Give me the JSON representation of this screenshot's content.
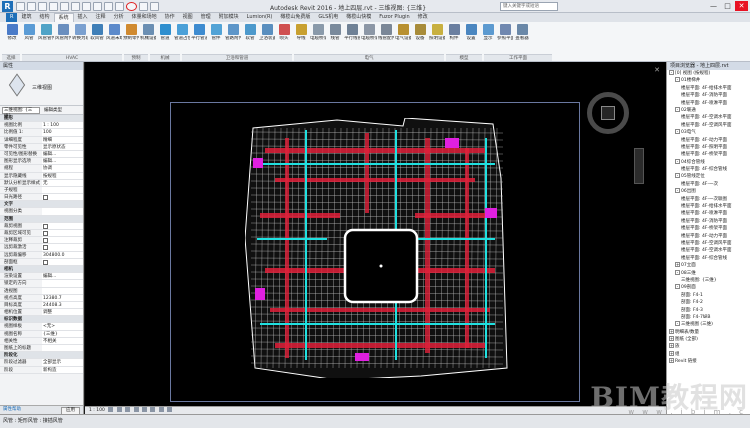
{
  "titlebar": {
    "title": "Autodesk Revit 2016 -    地上四层.rvt - 三维视图: {三维}",
    "search_placeholder": "键入关键字或短语",
    "minimize": "—",
    "maximize": "□",
    "close": "✕"
  },
  "tabs": [
    "R",
    "建筑",
    "结构",
    "系统",
    "插入",
    "注释",
    "分析",
    "体量和场地",
    "协作",
    "视图",
    "管理",
    "附加模块",
    "Lumion(R)",
    "橄榄山免费版",
    "GLS机电",
    "橄榄山快模",
    "Fuzor Plugin",
    "修改"
  ],
  "active_tab_index": 3,
  "ribbon": {
    "buttons": [
      {
        "label": "修改",
        "icon": "modify-arrow-icon"
      },
      {
        "label": "风管",
        "icon": "duct-icon"
      },
      {
        "label": "风管管件",
        "icon": "duct-fitting-icon"
      },
      {
        "label": "风管附件",
        "icon": "duct-accessory-icon"
      },
      {
        "label": "转换为软风管",
        "icon": "convert-flex-icon"
      },
      {
        "label": "软风管",
        "icon": "flex-duct-icon"
      },
      {
        "label": "风道末端",
        "icon": "air-terminal-icon"
      },
      {
        "label": "预制零件",
        "icon": "fabrication-icon"
      },
      {
        "label": "机械设备",
        "icon": "mechanical-equipment-icon"
      },
      {
        "label": "管道",
        "icon": "pipe-icon"
      },
      {
        "label": "管道占位符",
        "icon": "pipe-placeholder-icon"
      },
      {
        "label": "平行管道",
        "icon": "parallel-pipes-icon"
      },
      {
        "label": "管件",
        "icon": "pipe-fitting-icon"
      },
      {
        "label": "管路附件",
        "icon": "pipe-accessory-icon"
      },
      {
        "label": "软管",
        "icon": "flex-pipe-icon"
      },
      {
        "label": "卫浴装置",
        "icon": "plumbing-fixture-icon"
      },
      {
        "label": "喷头",
        "icon": "sprinkler-icon"
      },
      {
        "label": "导线",
        "icon": "wire-icon"
      },
      {
        "label": "电缆桥架",
        "icon": "cable-tray-icon"
      },
      {
        "label": "线管",
        "icon": "conduit-icon"
      },
      {
        "label": "平行线管",
        "icon": "parallel-conduit-icon"
      },
      {
        "label": "电缆桥架配件",
        "icon": "tray-fitting-icon"
      },
      {
        "label": "线管配件",
        "icon": "conduit-fitting-icon"
      },
      {
        "label": "电气设备",
        "icon": "electrical-equipment-icon"
      },
      {
        "label": "设备",
        "icon": "device-icon"
      },
      {
        "label": "照明设备",
        "icon": "lighting-fixture-icon"
      },
      {
        "label": "构件",
        "icon": "component-icon"
      },
      {
        "label": "设置",
        "icon": "set-workplane-icon"
      },
      {
        "label": "显示",
        "icon": "show-icon"
      },
      {
        "label": "参照平面",
        "icon": "ref-plane-icon"
      },
      {
        "label": "查看器",
        "icon": "viewer-icon"
      }
    ],
    "panels": [
      "选择",
      "HVAC",
      "预制",
      "机械",
      "卫浴和管道",
      "电气",
      "模型",
      "工作平面"
    ]
  },
  "properties": {
    "header": "属性",
    "type_name": "三维视图",
    "selector": "三维视图: {三维}",
    "edit_type": "编辑类型",
    "rows": [
      {
        "k": "图形",
        "v": "",
        "group": true
      },
      {
        "k": "视图比例",
        "v": "1 : 100"
      },
      {
        "k": "比例值 1:",
        "v": "100"
      },
      {
        "k": "详细程度",
        "v": "精细"
      },
      {
        "k": "零件可见性",
        "v": "显示原状态"
      },
      {
        "k": "可见性/图形替换",
        "v": "编辑..."
      },
      {
        "k": "图形显示选项",
        "v": "编辑..."
      },
      {
        "k": "规程",
        "v": "协调"
      },
      {
        "k": "显示隐藏线",
        "v": "按规程"
      },
      {
        "k": "默认分析显示样式",
        "v": "无"
      },
      {
        "k": "子规程",
        "v": ""
      },
      {
        "k": "日光路径",
        "v": "",
        "check": true
      },
      {
        "k": "文字",
        "v": "",
        "group": true
      },
      {
        "k": "视图分类",
        "v": ""
      },
      {
        "k": "范围",
        "v": "",
        "group": true
      },
      {
        "k": "裁剪视图",
        "v": "",
        "check": true
      },
      {
        "k": "裁剪区域可见",
        "v": "",
        "check": true
      },
      {
        "k": "注释裁剪",
        "v": "",
        "check": true
      },
      {
        "k": "远剪裁激活",
        "v": "",
        "check": true
      },
      {
        "k": "远剪裁偏移",
        "v": "304800.0"
      },
      {
        "k": "剖面框",
        "v": "",
        "check": true
      },
      {
        "k": "相机",
        "v": "",
        "group": true
      },
      {
        "k": "渲染设置",
        "v": "编辑..."
      },
      {
        "k": "锁定的方向",
        "v": ""
      },
      {
        "k": "透视图",
        "v": ""
      },
      {
        "k": "视点高度",
        "v": "12380.7"
      },
      {
        "k": "目标高度",
        "v": "24408.3"
      },
      {
        "k": "相机位置",
        "v": "调整"
      },
      {
        "k": "标识数据",
        "v": "",
        "group": true
      },
      {
        "k": "视图样板",
        "v": "<无>"
      },
      {
        "k": "视图名称",
        "v": "{三维}"
      },
      {
        "k": "相关性",
        "v": "不相关"
      },
      {
        "k": "图纸上的标题",
        "v": ""
      },
      {
        "k": "阶段化",
        "v": "",
        "group": true
      },
      {
        "k": "阶段过滤器",
        "v": "全部显示"
      },
      {
        "k": "阶段",
        "v": "新构造"
      }
    ],
    "help": "属性帮助",
    "apply": "应用"
  },
  "view": {
    "close_label": "✕",
    "scale": "1 : 100"
  },
  "browser": {
    "header": "项目浏览器 - 地上四层.rvt",
    "items": [
      {
        "t": "[0] 视图 (按规程)",
        "lvl": 0,
        "tg": "-"
      },
      {
        "t": "01楼梯井",
        "lvl": 1,
        "tg": "-"
      },
      {
        "t": "楼层平面: 4F-给排水平面",
        "lvl": 2
      },
      {
        "t": "楼层平面: 4F-消防平面",
        "lvl": 2
      },
      {
        "t": "楼层平面: 4F-喷淋平面",
        "lvl": 2
      },
      {
        "t": "02暖通",
        "lvl": 1,
        "tg": "-"
      },
      {
        "t": "楼层平面: 4F-空调水平面",
        "lvl": 2
      },
      {
        "t": "楼层平面: 4F-空调风平面",
        "lvl": 2
      },
      {
        "t": "03电气",
        "lvl": 1,
        "tg": "-"
      },
      {
        "t": "楼层平面: 4F-动力平面",
        "lvl": 2
      },
      {
        "t": "楼层平面: 4F-照明平面",
        "lvl": 2
      },
      {
        "t": "楼层平面: 4F-桥架平面",
        "lvl": 2
      },
      {
        "t": "04综合管线",
        "lvl": 1,
        "tg": "-"
      },
      {
        "t": "楼层平面: 4F-综合管线",
        "lvl": 2
      },
      {
        "t": "05管线定位",
        "lvl": 1,
        "tg": "-"
      },
      {
        "t": "楼层平面: 4F-一次",
        "lvl": 2
      },
      {
        "t": "06出图",
        "lvl": 1,
        "tg": "-"
      },
      {
        "t": "楼层平面: 4F-一次联图",
        "lvl": 2
      },
      {
        "t": "楼层平面: 4F-给排水平面",
        "lvl": 2
      },
      {
        "t": "楼层平面: 4F-喷淋平面",
        "lvl": 2
      },
      {
        "t": "楼层平面: 4F-消防平面",
        "lvl": 2
      },
      {
        "t": "楼层平面: 4F-桥架平面",
        "lvl": 2
      },
      {
        "t": "楼层平面: 4F-动力平面",
        "lvl": 2
      },
      {
        "t": "楼层平面: 4F-空调风平面",
        "lvl": 2
      },
      {
        "t": "楼层平面: 4F-空调水平面",
        "lvl": 2
      },
      {
        "t": "楼层平面: 4F-综合管线",
        "lvl": 2
      },
      {
        "t": "07立面",
        "lvl": 1,
        "tg": "+"
      },
      {
        "t": "08三维",
        "lvl": 1,
        "tg": "-"
      },
      {
        "t": "三维视图: {三维}",
        "lvl": 2
      },
      {
        "t": "09剖面",
        "lvl": 1,
        "tg": "-"
      },
      {
        "t": "剖面: F4-1",
        "lvl": 2
      },
      {
        "t": "剖面: F4-2",
        "lvl": 2
      },
      {
        "t": "剖面: F4-3",
        "lvl": 2
      },
      {
        "t": "剖面: F4-7纵B",
        "lvl": 2
      },
      {
        "t": "三维视图 (三维)",
        "lvl": 1,
        "tg": "-"
      },
      {
        "t": "明细表/数量",
        "lvl": 0,
        "tg": "+"
      },
      {
        "t": "图纸 (全部)",
        "lvl": 0,
        "tg": "+"
      },
      {
        "t": "族",
        "lvl": 0,
        "tg": "+"
      },
      {
        "t": "组",
        "lvl": 0,
        "tg": "+"
      },
      {
        "t": "Revit 链接",
        "lvl": 0,
        "tg": "+"
      }
    ]
  },
  "statusbar": {
    "text": "风管 : 矩形风管 : 接插风管"
  },
  "watermark": {
    "main": "BIM教程网",
    "sub": "w w w . i b i m . c"
  },
  "colors": {
    "accent": "#1e6fb8",
    "view_bg": "#000000",
    "drawing_white": "#ffffff",
    "duct_red": "#e0203a",
    "pipe_cyan": "#20e0e0",
    "magenta": "#e020e0"
  }
}
